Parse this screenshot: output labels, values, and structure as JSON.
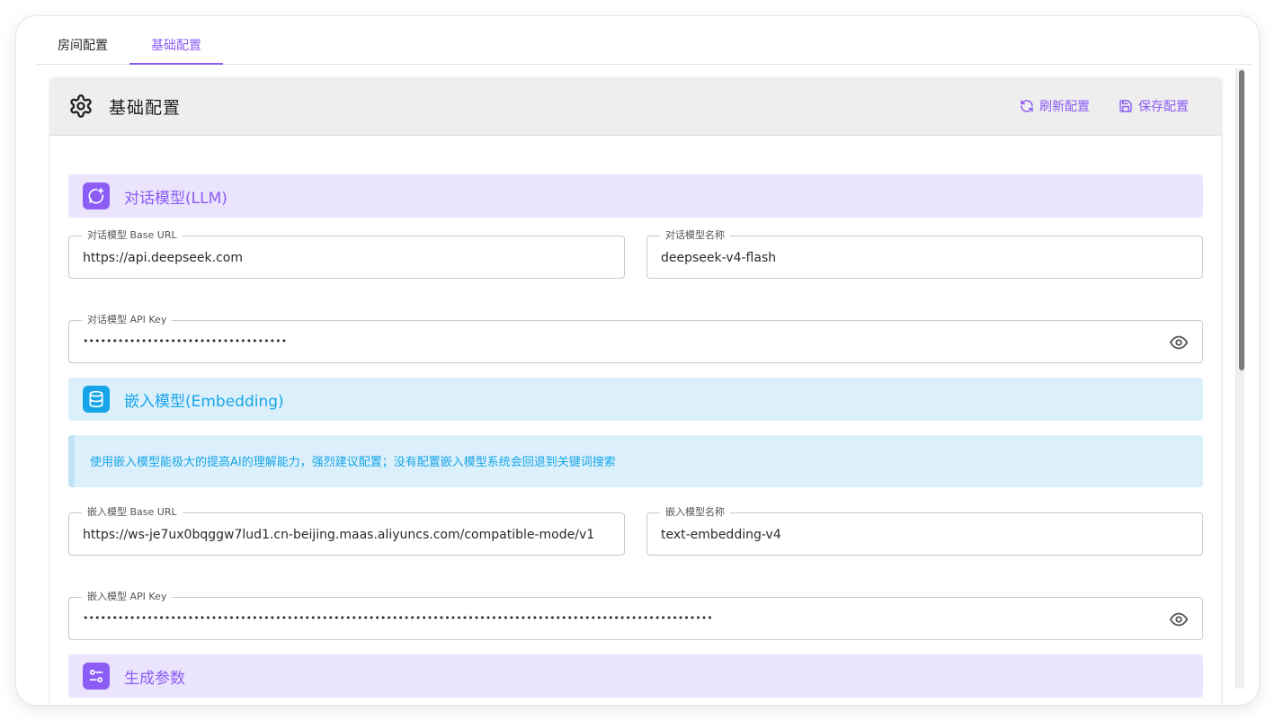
{
  "tabs": [
    {
      "label": "房间配置",
      "active": false
    },
    {
      "label": "基础配置",
      "active": true
    }
  ],
  "header": {
    "title": "基础配置",
    "refresh_label": "刷新配置",
    "save_label": "保存配置",
    "icon": "gear-icon"
  },
  "llm_section": {
    "title": "对话模型(LLM)",
    "icon": "chat-sparkle-icon",
    "base_url": {
      "label": "对话模型 Base URL",
      "value": "https://api.deepseek.com"
    },
    "model_name": {
      "label": "对话模型名称",
      "value": "deepseek-v4-flash"
    },
    "api_key": {
      "label": "对话模型 API Key",
      "value": "•••••••••••••••••••••••••••••••••••"
    }
  },
  "embedding_section": {
    "title": "嵌入模型(Embedding)",
    "icon": "database-icon",
    "notice": "使用嵌入模型能极大的提高AI的理解能力，强烈建议配置；没有配置嵌入模型系统会回退到关键词搜索",
    "base_url": {
      "label": "嵌入模型 Base URL",
      "value": "https://ws-je7ux0bqggw7lud1.cn-beijing.maas.aliyuncs.com/compatible-mode/v1"
    },
    "model_name": {
      "label": "嵌入模型名称",
      "value": "text-embedding-v4"
    },
    "api_key": {
      "label": "嵌入模型 API Key",
      "value": "••••••••••••••••••••••••••••••••••••••••••••••••••••••••••••••••••••••••••••••••••••••••••••••••••••••••••••"
    }
  },
  "gen_section": {
    "title": "生成参数",
    "icon": "sliders-icon"
  },
  "colors": {
    "accent": "#8b5cf6",
    "info": "#16a5e9",
    "purple_bg": "#ebe4fd",
    "blue_bg": "#dcf0fb"
  }
}
